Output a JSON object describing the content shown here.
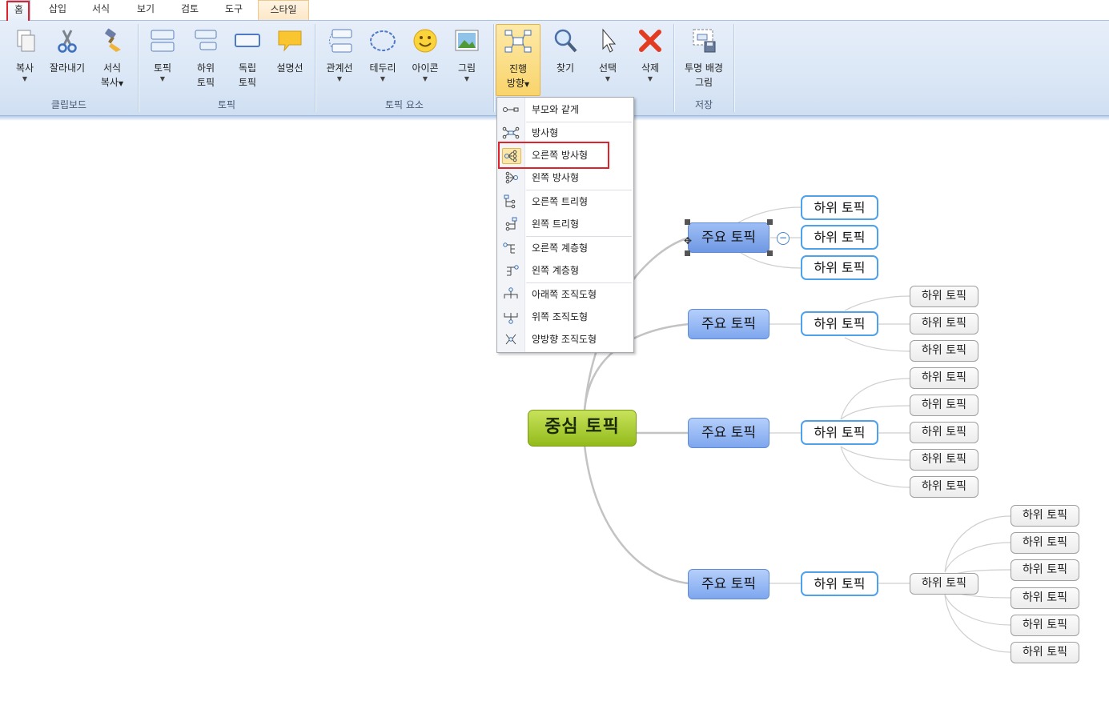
{
  "tabs": [
    {
      "label": "홈",
      "active": true
    },
    {
      "label": "삽입"
    },
    {
      "label": "서식"
    },
    {
      "label": "보기"
    },
    {
      "label": "검토"
    },
    {
      "label": "도구"
    },
    {
      "label": "스타일"
    }
  ],
  "ribbon": {
    "buttons": {
      "copy": "복사",
      "cut": "잘라내기",
      "format_copy_1": "서식",
      "format_copy_2": "복사",
      "topic": "토픽",
      "subtopic_1": "하위",
      "subtopic_2": "토픽",
      "floating_1": "독립",
      "floating_2": "토픽",
      "callout": "설명선",
      "relationship": "관계선",
      "boundary": "테두리",
      "icon": "아이콘",
      "picture": "그림",
      "direction_1": "진행",
      "direction_2": "방향",
      "find": "찾기",
      "select": "선택",
      "delete": "삭제",
      "transparent_1": "투명 배경",
      "transparent_2": "그림"
    },
    "groups": {
      "clipboard": "클립보드",
      "topic": "토픽",
      "topic_elements": "토픽 요소",
      "save": "저장"
    }
  },
  "layout_menu": {
    "items": [
      {
        "label": "부모와 같게",
        "icon": "same-as-parent-icon"
      },
      {
        "label": "방사형",
        "icon": "radial-icon"
      },
      {
        "label": "오른쪽 방사형",
        "icon": "right-radial-icon",
        "highlighted": true
      },
      {
        "label": "왼쪽 방사형",
        "icon": "left-radial-icon"
      },
      {
        "label": "오른쪽 트리형",
        "icon": "right-tree-icon"
      },
      {
        "label": "왼쪽 트리형",
        "icon": "left-tree-icon"
      },
      {
        "label": "오른쪽 계층형",
        "icon": "right-hierarchy-icon"
      },
      {
        "label": "왼쪽 계층형",
        "icon": "left-hierarchy-icon"
      },
      {
        "label": "아래쪽 조직도형",
        "icon": "org-chart-down-icon"
      },
      {
        "label": "위쪽 조직도형",
        "icon": "org-chart-up-icon"
      },
      {
        "label": "양방향 조직도형",
        "icon": "org-chart-both-icon"
      }
    ]
  },
  "mindmap": {
    "central": "중심 토픽",
    "main_topic": "주요 토픽",
    "subtopic": "하위 토픽",
    "branches": [
      {
        "main": "주요 토픽",
        "selected": true,
        "children": [
          "하위 토픽",
          "하위 토픽",
          "하위 토픽"
        ]
      },
      {
        "main": "주요 토픽",
        "children": [
          {
            "label": "하위 토픽",
            "children": [
              "하위 토픽",
              "하위 토픽",
              "하위 토픽"
            ]
          }
        ]
      },
      {
        "main": "주요 토픽",
        "children": [
          {
            "label": "하위 토픽",
            "children": [
              "하위 토픽",
              "하위 토픽",
              "하위 토픽",
              "하위 토픽",
              "하위 토픽"
            ]
          }
        ]
      },
      {
        "main": "주요 토픽",
        "children": [
          {
            "label": "하위 토픽",
            "children": [
              {
                "label": "하위 토픽",
                "children": [
                  "하위 토픽",
                  "하위 토픽",
                  "하위 토픽",
                  "하위 토픽",
                  "하위 토픽",
                  "하위 토픽"
                ]
              }
            ]
          }
        ]
      }
    ]
  },
  "colors": {
    "accent_red": "#e0222a",
    "central_green": "#9bc327",
    "main_blue": "#8ab0f0",
    "sub_border": "#4ea2ec"
  }
}
